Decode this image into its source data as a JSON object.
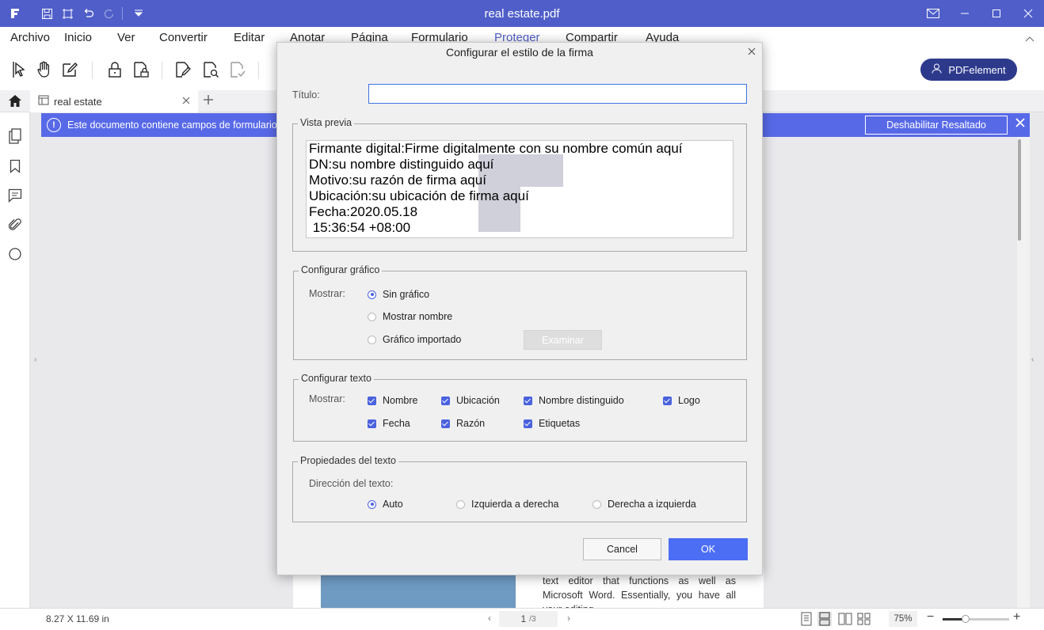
{
  "window": {
    "title": "real estate.pdf"
  },
  "menu": {
    "items": [
      "Archivo",
      "Inicio",
      "Ver",
      "Convertir",
      "Editar",
      "Anotar",
      "Página",
      "Formulario",
      "Proteger",
      "Compartir",
      "Ayuda"
    ],
    "active": "Proteger"
  },
  "toolbar": {
    "account_label": "PDFelement"
  },
  "tabs": {
    "doc_label": "real estate"
  },
  "banner": {
    "message": "Este documento contiene campos de formulario",
    "disable_button": "Deshabilitar Resaltado"
  },
  "document": {
    "text": "text editor that functions as well as Microsoft Word. Essentially, you have all your editing"
  },
  "status": {
    "page_size": "8.27 X 11.69 in",
    "current_page": "1",
    "total_pages": "/3",
    "zoom": "75%"
  },
  "dialog": {
    "title": "Configurar el estilo de la firma",
    "title_label": "Título:",
    "title_value": "",
    "preview_legend": "Vista previa",
    "preview_lines": [
      "Firmante digital:Firme digitalmente con su nombre común aquí",
      "DN:su nombre distinguido aquí",
      "Motivo:su razón de firma aquí",
      "Ubicación:su ubicación de firma aquí",
      "Fecha:2020.05.18",
      " 15:36:54 +08:00"
    ],
    "graphic": {
      "legend": "Configurar gráfico",
      "show_label": "Mostrar:",
      "options": [
        "Sin gráfico",
        "Mostrar nombre",
        "Gráfico importado"
      ],
      "selected": "Sin gráfico",
      "browse_button": "Examinar"
    },
    "text_config": {
      "legend": "Configurar texto",
      "show_label": "Mostrar:",
      "checkboxes": [
        "Nombre",
        "Ubicación",
        "Nombre distinguido",
        "Logo",
        "Fecha",
        "Razón",
        "Etiquetas"
      ],
      "all_checked": true
    },
    "text_props": {
      "legend": "Propiedades del texto",
      "direction_label": "Dirección del texto:",
      "options": [
        "Auto",
        "Izquierda a derecha",
        "Derecha a izquierda"
      ],
      "selected": "Auto"
    },
    "cancel_label": "Cancel",
    "ok_label": "OK"
  },
  "colors": {
    "accent": "#4f5ec9",
    "banner": "#5869e8",
    "ok_button": "#4c6ef5",
    "account_button": "#2d3a8c"
  }
}
